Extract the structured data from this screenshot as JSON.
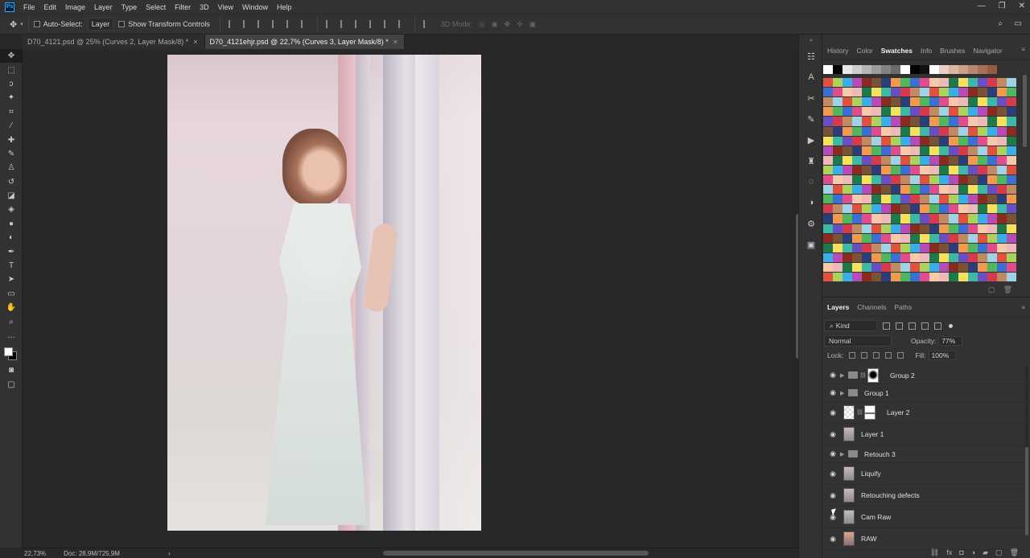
{
  "app": {
    "logo": "Ps"
  },
  "menubar": {
    "items": [
      "File",
      "Edit",
      "Image",
      "Layer",
      "Type",
      "Select",
      "Filter",
      "3D",
      "View",
      "Window",
      "Help"
    ],
    "window_controls": [
      "—",
      "❐",
      "✕"
    ]
  },
  "options": {
    "auto_select_label": "Auto-Select:",
    "auto_select_value": "Layer",
    "show_transform_label": "Show Transform Controls",
    "mode_3d_label": "3D Mode:"
  },
  "tabs": [
    {
      "label": "D70_4121.psd @ 25% (Curves 2, Layer Mask/8) *",
      "close": "×"
    },
    {
      "label": "D70_4121ehjr.psd @ 22,7% (Curves 3, Layer Mask/8) *",
      "close": "×"
    }
  ],
  "status": {
    "zoom": "22,73%",
    "doc": "Doc: 28,9M/725,9M",
    "arrow": "›"
  },
  "swatches_panel": {
    "tabs": [
      "History",
      "Color",
      "Swatches",
      "Info",
      "Brushes",
      "Navigator"
    ],
    "active_tab": "Swatches"
  },
  "layers_panel": {
    "tabs": [
      "Layers",
      "Channels",
      "Paths"
    ],
    "active_tab": "Layers",
    "filter_kind": "Kind",
    "blend_mode": "Normal",
    "opacity_label": "Opacity:",
    "opacity_value": "77%",
    "lock_label": "Lock:",
    "fill_label": "Fill:",
    "fill_value": "100%",
    "layers": [
      {
        "name": "Group 2",
        "type": "group-mask"
      },
      {
        "name": "Group 1",
        "type": "group"
      },
      {
        "name": "Layer 2",
        "type": "layer-mask"
      },
      {
        "name": "Layer 1",
        "type": "layer"
      },
      {
        "name": "Retouch 3",
        "type": "group"
      },
      {
        "name": "Liquify",
        "type": "layer"
      },
      {
        "name": "Retouching defects",
        "type": "layer"
      },
      {
        "name": "Cam Raw",
        "type": "layer"
      },
      {
        "name": "RAW",
        "type": "layer"
      }
    ]
  }
}
